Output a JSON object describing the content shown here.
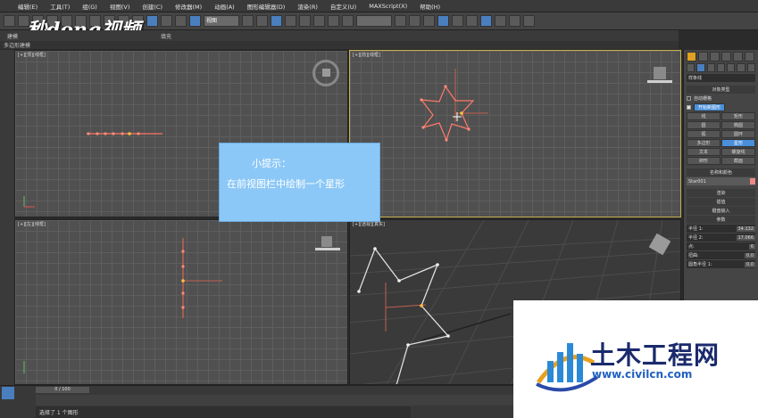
{
  "menu": [
    "编辑(E)",
    "工具(T)",
    "组(G)",
    "视图(V)",
    "创建(C)",
    "修改器(M)",
    "动画(A)",
    "图形编辑器(D)",
    "渲染(R)",
    "自定义(U)",
    "MAXScript(X)",
    "帮助(H)"
  ],
  "toolbar": {
    "view_dropdown": "视图"
  },
  "logo": "秒dong视频",
  "ribbon": {
    "tab1": "建模",
    "tab2": "填充"
  },
  "subribbon": "多边形建模",
  "viewports": {
    "top": "[+][顶][线框]",
    "front": "[+][前][线框]",
    "left": "[+][左][线框]",
    "persp": "[+][透视][真实]"
  },
  "tip": {
    "line1": "小提示：",
    "line2": "在前视图栏中绘制一个星形"
  },
  "cmdpanel": {
    "dropdown": "样条线",
    "object_type": "对象类型",
    "auto_grid": "自动栅格",
    "start_new": "开始新图形",
    "buttons": [
      [
        "线",
        "矩形"
      ],
      [
        "圆",
        "椭圆"
      ],
      [
        "弧",
        "圆环"
      ],
      [
        "多边形",
        "星形"
      ],
      [
        "文本",
        "螺旋线"
      ],
      [
        "卵形",
        "截面"
      ]
    ],
    "name_color": "名称和颜色",
    "name_value": "Star001",
    "rollouts": [
      "渲染",
      "插值",
      "键盘输入",
      "参数"
    ],
    "params": [
      [
        "半径 1:",
        "34.132"
      ],
      [
        "半径 2:",
        "17.066"
      ],
      [
        "点:",
        "6"
      ],
      [
        "扭曲:",
        "0.0"
      ],
      [
        "圆角半径 1:",
        "0.0"
      ]
    ]
  },
  "timeline": {
    "frame": "0 / 100"
  },
  "status": "选择了 1 个图形",
  "watermark": {
    "cn": "土木工程网",
    "url": "www.civilcn.com"
  }
}
